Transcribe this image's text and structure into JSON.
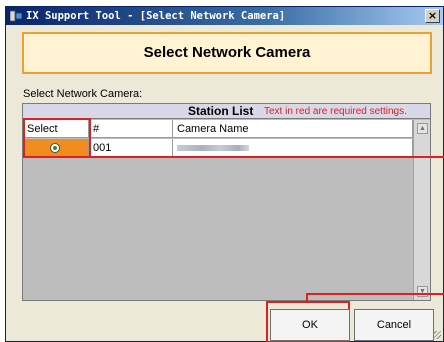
{
  "window": {
    "title": "IX Support Tool - [Select Network Camera]",
    "close_label": "×"
  },
  "heading": "Select Network Camera",
  "section_label": "Select Network Camera:",
  "table": {
    "title": "Station List",
    "required_note": "Text in red are required settings.",
    "columns": [
      "Select",
      "#",
      "Camera Name"
    ],
    "rows": [
      {
        "selected": true,
        "number": "001",
        "camera_name": ""
      }
    ]
  },
  "buttons": {
    "ok": "OK",
    "cancel": "Cancel"
  },
  "colors": {
    "heading_border": "#f0a030",
    "heading_background": "#fff3d4",
    "selected_cell": "#f08c20",
    "row_background": "#ffffff",
    "table_background": "#bdbdbd",
    "required_text": "#e02020",
    "annotation_red": "#e02020"
  },
  "icons": {
    "app": "app-icon",
    "radio": "radio-selected-icon",
    "scroll_up": "scroll-up-icon",
    "scroll_down": "scroll-down-icon"
  }
}
